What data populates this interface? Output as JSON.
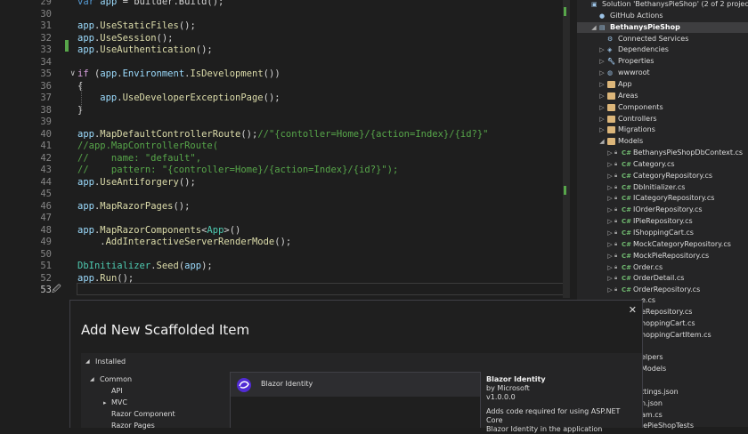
{
  "editor": {
    "lines": [
      {
        "n": "29",
        "segs": [
          [
            "var app = builder.Build();",
            "p"
          ]
        ]
      },
      {
        "n": "30",
        "segs": []
      },
      {
        "n": "31",
        "segs": [
          [
            "app",
            "id"
          ],
          [
            ".",
            "p"
          ],
          [
            "UseStaticFiles",
            "m"
          ],
          [
            "();",
            "p"
          ]
        ]
      },
      {
        "n": "32",
        "segs": [
          [
            "app",
            "id"
          ],
          [
            ".",
            "p"
          ],
          [
            "UseSession",
            "m"
          ],
          [
            "();",
            "p"
          ]
        ]
      },
      {
        "n": "33",
        "segs": [
          [
            "app",
            "id"
          ],
          [
            ".",
            "p"
          ],
          [
            "UseAuthentication",
            "m"
          ],
          [
            "();",
            "p"
          ]
        ]
      },
      {
        "n": "34",
        "segs": []
      },
      {
        "n": "35",
        "segs": [
          [
            "if",
            "ctrl"
          ],
          [
            " (",
            "p"
          ],
          [
            "app",
            "id"
          ],
          [
            ".",
            "p"
          ],
          [
            "Environment",
            "id"
          ],
          [
            ".",
            "p"
          ],
          [
            "IsDevelopment",
            "m"
          ],
          [
            "())",
            "p"
          ]
        ]
      },
      {
        "n": "36",
        "segs": [
          [
            "{",
            "p"
          ]
        ]
      },
      {
        "n": "37",
        "segs": [
          [
            "    app",
            "id"
          ],
          [
            ".",
            "p"
          ],
          [
            "UseDeveloperExceptionPage",
            "m"
          ],
          [
            "();",
            "p"
          ]
        ]
      },
      {
        "n": "38",
        "segs": [
          [
            "}",
            "p"
          ]
        ]
      },
      {
        "n": "39",
        "segs": []
      },
      {
        "n": "40",
        "segs": [
          [
            "app",
            "id"
          ],
          [
            ".",
            "p"
          ],
          [
            "MapDefaultControllerRoute",
            "m"
          ],
          [
            "();",
            "p"
          ],
          [
            "//\"{contoller=Home}/{action=Index}/{id?}\"",
            "c"
          ]
        ]
      },
      {
        "n": "41",
        "segs": [
          [
            "//app.MapControllerRoute(",
            "c"
          ]
        ]
      },
      {
        "n": "42",
        "segs": [
          [
            "//    name: \"default\",",
            "c"
          ]
        ]
      },
      {
        "n": "43",
        "segs": [
          [
            "//    pattern: \"{controller=Home}/{action=Index}/{id?}\");",
            "c"
          ]
        ]
      },
      {
        "n": "44",
        "segs": [
          [
            "app",
            "id"
          ],
          [
            ".",
            "p"
          ],
          [
            "UseAntiforgery",
            "m"
          ],
          [
            "();",
            "p"
          ]
        ]
      },
      {
        "n": "45",
        "segs": []
      },
      {
        "n": "46",
        "segs": [
          [
            "app",
            "id"
          ],
          [
            ".",
            "p"
          ],
          [
            "MapRazorPages",
            "m"
          ],
          [
            "();",
            "p"
          ]
        ]
      },
      {
        "n": "47",
        "segs": []
      },
      {
        "n": "48",
        "segs": [
          [
            "app",
            "id"
          ],
          [
            ".",
            "p"
          ],
          [
            "MapRazorComponents",
            "m"
          ],
          [
            "<",
            "p"
          ],
          [
            "App",
            "t"
          ],
          [
            ">()",
            "p"
          ]
        ]
      },
      {
        "n": "49",
        "segs": [
          [
            "    .",
            "p"
          ],
          [
            "AddInteractiveServerRenderMode",
            "m"
          ],
          [
            "();",
            "p"
          ]
        ]
      },
      {
        "n": "50",
        "segs": []
      },
      {
        "n": "51",
        "segs": [
          [
            "DbInitializer",
            "t"
          ],
          [
            ".",
            "p"
          ],
          [
            "Seed",
            "m"
          ],
          [
            "(",
            "p"
          ],
          [
            "app",
            "id"
          ],
          [
            ");",
            "p"
          ]
        ]
      },
      {
        "n": "52",
        "segs": [
          [
            "app",
            "id"
          ],
          [
            ".",
            "p"
          ],
          [
            "Run",
            "m"
          ],
          [
            "();",
            "p"
          ]
        ]
      },
      {
        "n": "53",
        "segs": []
      }
    ]
  },
  "solution_explorer": {
    "items": [
      {
        "label": "Solution 'BethanysPieShop' (2 of 2 projects)",
        "indent": 0,
        "icon": "solution-icon",
        "arrow": ""
      },
      {
        "label": "GitHub Actions",
        "indent": 1,
        "icon": "github-icon",
        "arrow": ""
      },
      {
        "label": "BethanysPieShop",
        "indent": 1,
        "icon": "project-icon",
        "arrow": "down",
        "selected": true
      },
      {
        "label": "Connected Services",
        "indent": 2,
        "icon": "connected-services-icon",
        "arrow": ""
      },
      {
        "label": "Dependencies",
        "indent": 2,
        "icon": "dependencies-icon",
        "arrow": "right"
      },
      {
        "label": "Properties",
        "indent": 2,
        "icon": "properties-icon",
        "arrow": "right"
      },
      {
        "label": "wwwroot",
        "indent": 2,
        "icon": "globe-icon",
        "arrow": "right"
      },
      {
        "label": "App",
        "indent": 2,
        "icon": "folder-icon",
        "arrow": "right"
      },
      {
        "label": "Areas",
        "indent": 2,
        "icon": "folder-icon",
        "arrow": "right"
      },
      {
        "label": "Components",
        "indent": 2,
        "icon": "folder-icon",
        "arrow": "right"
      },
      {
        "label": "Controllers",
        "indent": 2,
        "icon": "folder-icon",
        "arrow": "right"
      },
      {
        "label": "Migrations",
        "indent": 2,
        "icon": "folder-icon",
        "arrow": "right"
      },
      {
        "label": "Models",
        "indent": 2,
        "icon": "folder-icon",
        "arrow": "down"
      },
      {
        "label": "BethanysPieShopDbContext.cs",
        "indent": 3,
        "icon": "csharp-file-icon",
        "arrow": "right"
      },
      {
        "label": "Category.cs",
        "indent": 3,
        "icon": "csharp-file-icon",
        "arrow": "right"
      },
      {
        "label": "CategoryRepository.cs",
        "indent": 3,
        "icon": "csharp-file-icon",
        "arrow": "right"
      },
      {
        "label": "DbInitializer.cs",
        "indent": 3,
        "icon": "csharp-file-icon",
        "arrow": "right"
      },
      {
        "label": "ICategoryRepository.cs",
        "indent": 3,
        "icon": "csharp-file-icon",
        "arrow": "right"
      },
      {
        "label": "IOrderRepository.cs",
        "indent": 3,
        "icon": "csharp-file-icon",
        "arrow": "right"
      },
      {
        "label": "IPieRepository.cs",
        "indent": 3,
        "icon": "csharp-file-icon",
        "arrow": "right"
      },
      {
        "label": "IShoppingCart.cs",
        "indent": 3,
        "icon": "csharp-file-icon",
        "arrow": "right"
      },
      {
        "label": "MockCategoryRepository.cs",
        "indent": 3,
        "icon": "csharp-file-icon",
        "arrow": "right"
      },
      {
        "label": "MockPieRepository.cs",
        "indent": 3,
        "icon": "csharp-file-icon",
        "arrow": "right"
      },
      {
        "label": "Order.cs",
        "indent": 3,
        "icon": "csharp-file-icon",
        "arrow": "right"
      },
      {
        "label": "OrderDetail.cs",
        "indent": 3,
        "icon": "csharp-file-icon",
        "arrow": "right"
      },
      {
        "label": "OrderRepository.cs",
        "indent": 3,
        "icon": "csharp-file-icon",
        "arrow": "right"
      }
    ],
    "peek_items": [
      "e.cs",
      "eRepository.cs",
      "hoppingCart.cs",
      "hoppingCartItem.cs",
      "",
      "elpers",
      "Models",
      "",
      "ttings.json",
      "n.json",
      "am.cs",
      "iePieShopTests"
    ]
  },
  "dialog": {
    "title": "Add New Scaffolded Item",
    "close_glyph": "✕",
    "tree": {
      "installed": "Installed",
      "common": "Common",
      "children": [
        "API",
        "MVC",
        "Razor Component",
        "Razor Pages"
      ]
    },
    "template": {
      "label": "Blazor Identity"
    },
    "details": {
      "name": "Blazor Identity",
      "author": "by Microsoft",
      "version": "v1.0.0.0",
      "description_line1": "Adds code required for using ASP.NET Core",
      "description_line2": "Blazor Identity in the application"
    }
  },
  "colors": {
    "editor_bg": "#1e1e1e",
    "panel_bg": "#252526",
    "accent": "#9cdcfe",
    "comment": "#57a64a"
  }
}
